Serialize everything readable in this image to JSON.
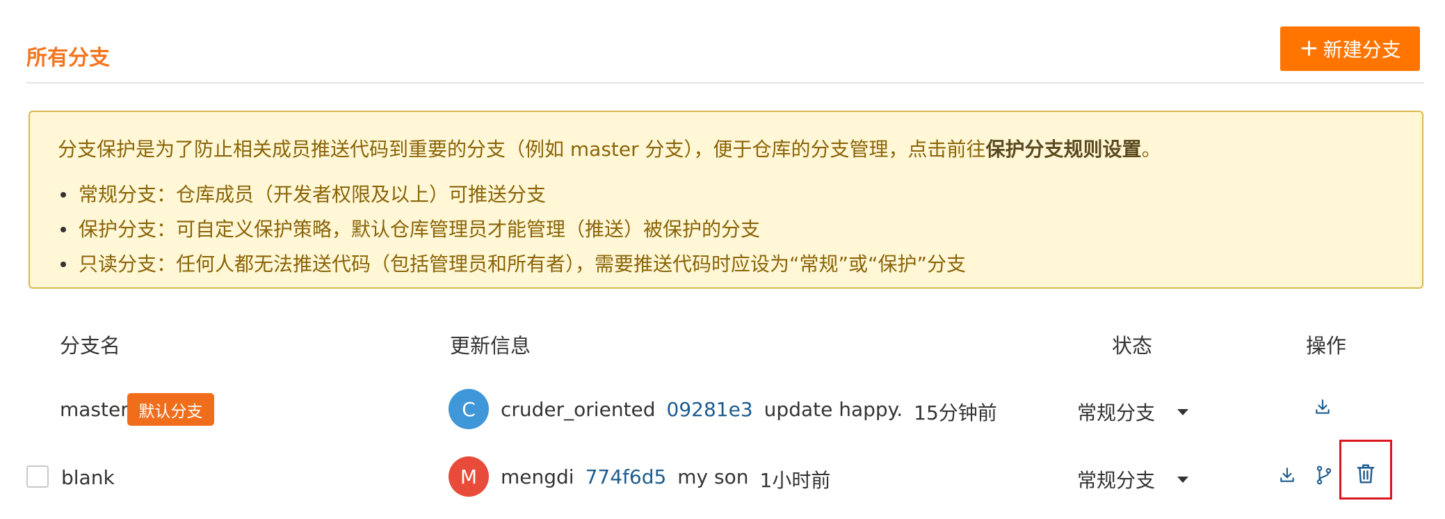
{
  "header": {
    "title": "所有分支",
    "new_branch_label": "新建分支"
  },
  "notice": {
    "lead_text": "分支保护是为了防止相关成员推送代码到重要的分支（例如 master 分支），便于仓库的分支管理，点击前往",
    "lead_link": "保护分支规则设置",
    "lead_end": "。",
    "items": [
      "常规分支：仓库成员（开发者权限及以上）可推送分支",
      "保护分支：可自定义保护策略，默认仓库管理员才能管理（推送）被保护的分支",
      "只读分支：任何人都无法推送代码（包括管理员和所有者），需要推送代码时应设为“常规”或“保护”分支"
    ]
  },
  "table": {
    "headers": {
      "name": "分支名",
      "update": "更新信息",
      "status": "状态",
      "actions": "操作"
    },
    "rows": [
      {
        "name": "master",
        "badge": "默认分支",
        "avatar_letter": "C",
        "avatar_color": "#3f97d8",
        "user": "cruder_oriented",
        "hash": "09281e3",
        "message": "update happy.",
        "time": "15分钟前",
        "status": "常规分支"
      },
      {
        "name": "blank",
        "avatar_letter": "M",
        "avatar_color": "#e84b3a",
        "user": "mengdi",
        "hash": "774f6d5",
        "message": "my son",
        "time": "1小时前",
        "status": "常规分支"
      }
    ]
  },
  "colors": {
    "accent": "#ff7500",
    "link": "#1d5b8e",
    "highlight": "#d9171f"
  },
  "icons": {
    "download": "download-icon",
    "branch": "git-branch-icon",
    "delete": "trash-icon"
  }
}
